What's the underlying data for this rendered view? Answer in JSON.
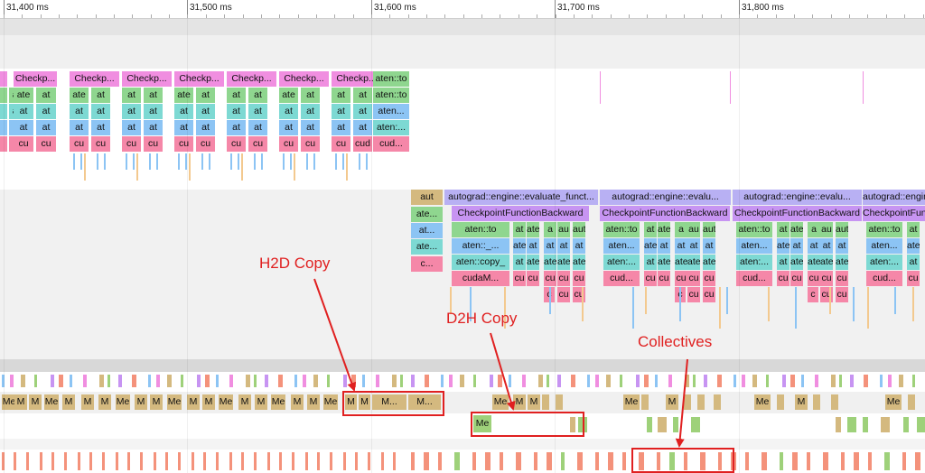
{
  "timeline": {
    "ruler_ticks": [
      "31,400 ms",
      "31,500 ms",
      "31,600 ms",
      "31,700 ms",
      "31,800 ms"
    ]
  },
  "colors": {
    "checkpoint": "#f08ee0",
    "aten_green": "#8fd68f",
    "aten_blue": "#8cc4f4",
    "aten_teal": "#7dd9d3",
    "cuda_pink": "#f587a8",
    "autograd": "#b8b0f3",
    "checkpoint_backward": "#c794f2",
    "memcpy": "#d4b97f",
    "memcpy_green": "#9ed17a",
    "nccl": "#f4927b",
    "annotation": "#e02020"
  },
  "threads": {
    "forward": {
      "checkpoint_label": "Checkp...",
      "aten_to": "aten::to",
      "aten_trunc": "aten...",
      "aten_colon": "aten:...",
      "cud": "cud...",
      "ate": "ate",
      "at": "at",
      "cu": "cu",
      "cud_short": "cud"
    },
    "backward": {
      "aut": "aut",
      "ate_trunc": "ate...",
      "at_trunc": "at...",
      "c_trunc": "c...",
      "autograd_label": "autograd::engine::evaluate_funct...",
      "autograd_label_short": "autograd::engine::evalu...",
      "checkpoint_backward": "CheckpointFunctionBackward",
      "aten_to": "aten::to",
      "aten_under": "aten::_...",
      "aten_copy": "aten::copy_",
      "cudam": "cudaM...",
      "aten_trunc": "aten...",
      "aten_colon": "aten:...",
      "cud": "cud...",
      "ate": "ate",
      "at": "at",
      "a": "a",
      "au": "au",
      "cu": "cu",
      "c": "c",
      "ut": "ut"
    },
    "gpu": {
      "me": "Me",
      "m": "M",
      "m_trunc": "M..."
    }
  },
  "annotations": {
    "h2d": "H2D Copy",
    "d2h": "D2H Copy",
    "collectives": "Collectives"
  }
}
